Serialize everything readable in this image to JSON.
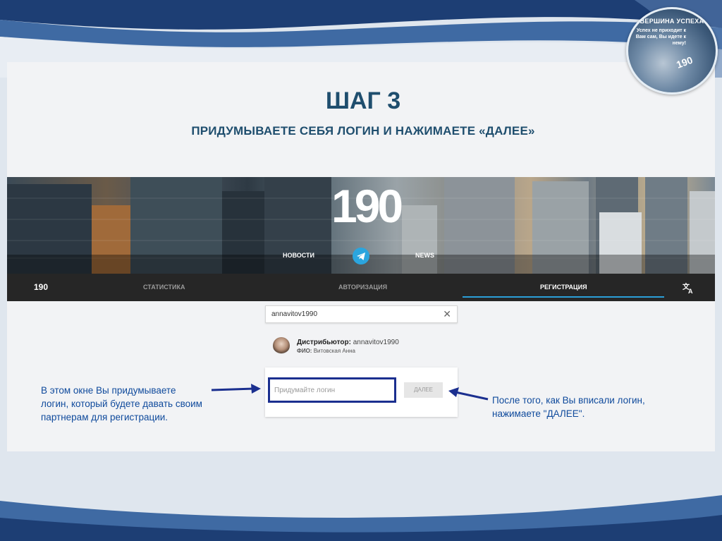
{
  "slide": {
    "badge": {
      "title": "ВЕРШИНА УСПЕХА",
      "text": "Успех не приходит к Вам сам, Вы идете к нему!",
      "number": "190"
    },
    "title": "ШАГ 3",
    "subtitle": "ПРИДУМЫВАЕТЕ СЕБЯ ЛОГИН И НАЖИМАЕТЕ «ДАЛЕЕ»"
  },
  "site": {
    "logo": "190",
    "hero_links": {
      "left": "НОВОСТИ",
      "right": "NEWS"
    },
    "nav": {
      "logo": "190",
      "tabs": [
        {
          "label": "СТАТИСТИКА",
          "active": false
        },
        {
          "label": "АВТОРИЗАЦИЯ",
          "active": false
        },
        {
          "label": "РЕГИСТРАЦИЯ",
          "active": true
        }
      ]
    },
    "search": {
      "value": "annavitov1990"
    },
    "distributor": {
      "label": "Дистрибьютор:",
      "value": "annavitov1990",
      "fio_label": "ФИО:",
      "fio_value": "Витовская Анна"
    },
    "login": {
      "placeholder": "Придумайте логин",
      "next_label": "ДАЛЕЕ"
    }
  },
  "annotations": {
    "left": [
      "В этом окне Вы придумываете",
      "логин, который будете давать своим",
      "партнерам для регистрации."
    ],
    "right": [
      "После того, как Вы вписали логин,",
      "нажимаете \"ДАЛЕЕ\"."
    ]
  },
  "colors": {
    "heading": "#1f4e6e",
    "annotation": "#0f4a9c",
    "highlight": "#1b2f8f",
    "accent": "#2b9fd8"
  }
}
